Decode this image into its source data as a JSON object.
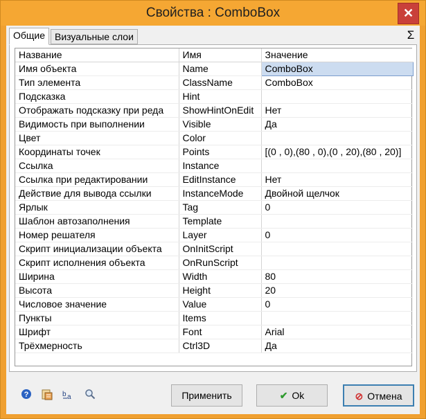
{
  "window": {
    "title": "Свойства :   ComboBox",
    "close_label": "✕"
  },
  "tabs": [
    {
      "label": "Общие",
      "active": true
    },
    {
      "label": "Визуальные слои",
      "active": false
    }
  ],
  "sigma_label": "Σ",
  "grid": {
    "columns": [
      "Название",
      "Имя",
      "Значение"
    ],
    "rows": [
      [
        "Имя объекта",
        "Name",
        "ComboBox"
      ],
      [
        "Тип элемента",
        "ClassName",
        "ComboBox"
      ],
      [
        "Подсказка",
        "Hint",
        ""
      ],
      [
        "Отображать подсказку при реда",
        "ShowHintOnEdit",
        "Нет"
      ],
      [
        "Видимость при выполнении",
        "Visible",
        "Да"
      ],
      [
        "Цвет",
        "Color",
        ""
      ],
      [
        "Координаты точек",
        "Points",
        "[(0 , 0),(80 , 0),(0 , 20),(80 , 20)]"
      ],
      [
        "Ссылка",
        "Instance",
        ""
      ],
      [
        "Ссылка при редактировании",
        "EditInstance",
        "Нет"
      ],
      [
        "Действие для вывода ссылки",
        "InstanceMode",
        "Двойной щелчок"
      ],
      [
        "Ярлык",
        "Tag",
        "0"
      ],
      [
        "Шаблон автозаполнения",
        "Template",
        ""
      ],
      [
        "Номер решателя",
        "Layer",
        "0"
      ],
      [
        "Скрипт инициализации объекта",
        "OnInitScript",
        ""
      ],
      [
        "Скрипт исполнения объекта",
        "OnRunScript",
        ""
      ],
      [
        "Ширина",
        "Width",
        "80"
      ],
      [
        "Высота",
        "Height",
        "20"
      ],
      [
        "Числовое значение",
        "Value",
        "0"
      ],
      [
        "Пункты",
        "Items",
        ""
      ],
      [
        "Шрифт",
        "Font",
        "Arial"
      ],
      [
        "Трёхмерность",
        "Ctrl3D",
        "Да"
      ]
    ],
    "selected_row": 0
  },
  "toolbar_icons": [
    "help-icon",
    "properties-icon",
    "text-format-icon",
    "search-icon"
  ],
  "buttons": {
    "apply": "Применить",
    "ok": "Ok",
    "cancel": "Отмена"
  },
  "colors": {
    "titlebar": "#f5a733",
    "selection": "#ccdcf0",
    "ok_icon": "#2e9a2e",
    "cancel_icon": "#d03030"
  }
}
